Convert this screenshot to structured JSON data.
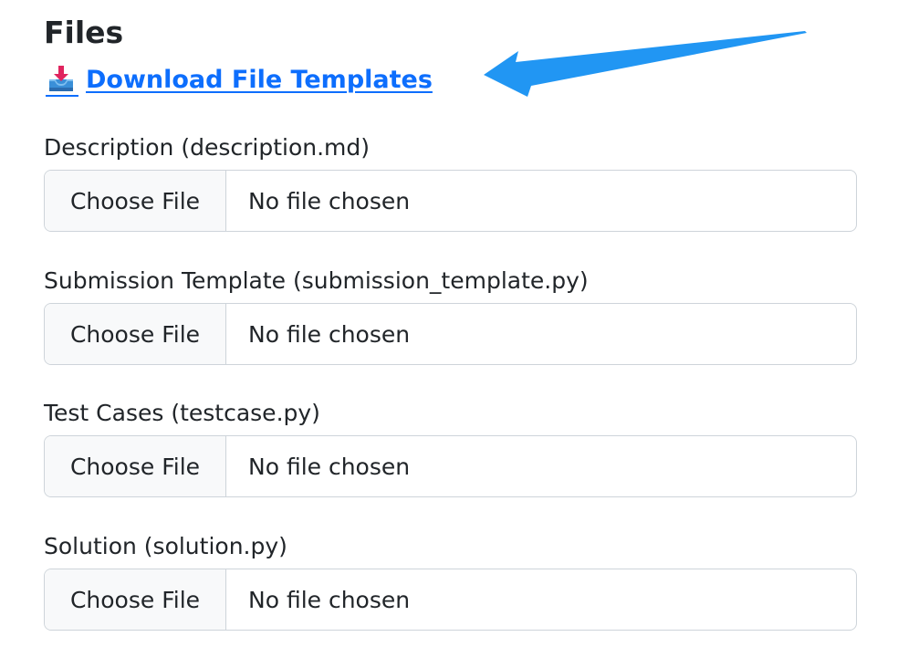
{
  "section": {
    "title": "Files"
  },
  "download": {
    "label": "Download File Templates",
    "icon": "inbox-tray-icon",
    "color": "#0d6efd"
  },
  "annotation": {
    "icon": "pointer-arrow-icon",
    "color": "#2196f3"
  },
  "fields": [
    {
      "label": "Description (description.md)",
      "button_label": "Choose File",
      "status": "No file chosen"
    },
    {
      "label": "Submission Template (submission_template.py)",
      "button_label": "Choose File",
      "status": "No file chosen"
    },
    {
      "label": "Test Cases (testcase.py)",
      "button_label": "Choose File",
      "status": "No file chosen"
    },
    {
      "label": "Solution (solution.py)",
      "button_label": "Choose File",
      "status": "No file chosen"
    }
  ]
}
